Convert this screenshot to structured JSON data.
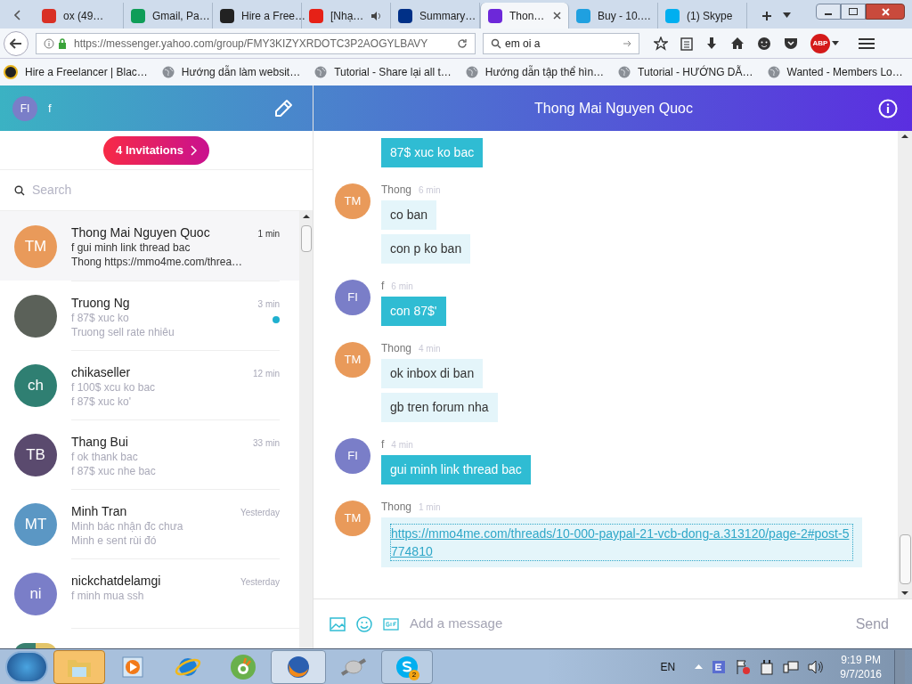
{
  "browser": {
    "tabs": [
      {
        "title": "ox (49…",
        "color": "#d93025",
        "selected": false,
        "audio": false
      },
      {
        "title": "Gmail, Pa…",
        "color": "#0f9d58",
        "selected": false,
        "audio": false
      },
      {
        "title": "Hire a Free…",
        "color": "#222222",
        "selected": false,
        "audio": false
      },
      {
        "title": "[Nhạ…",
        "color": "#e62117",
        "selected": false,
        "audio": true
      },
      {
        "title": "Summary…",
        "color": "#003087",
        "selected": false,
        "audio": false
      },
      {
        "title": "Thon…",
        "color": "#6d28d9",
        "selected": true,
        "audio": false
      },
      {
        "title": "Buy - 10.…",
        "color": "#1fa0e0",
        "selected": false,
        "audio": false
      },
      {
        "title": "(1) Skype",
        "color": "#00aff0",
        "selected": false,
        "audio": false
      }
    ],
    "url": "https://messenger.yahoo.com/group/FMY3KIZYXRDOTC3P2AOGYLBAVY",
    "search_value": "em oi a",
    "adblock_label": "ABP",
    "bookmarks": [
      "Hire a Freelancer | Blac…",
      "Hướng dẫn làm websit…",
      "Tutorial - Share lại all t…",
      "Hướng dẫn tập thể hìn…",
      "Tutorial - HƯỚNG DẪ…",
      "Wanted - Members Lo…"
    ]
  },
  "me": {
    "initials": "FI",
    "name": "f"
  },
  "invitations": "4 Invitations",
  "search": {
    "placeholder": "Search"
  },
  "conversations": [
    {
      "kind": "initials",
      "initials": "TM",
      "color": "#e99a5a",
      "name": "Thong Mai Nguyen Quoc",
      "line1": "f gui minh link thread bac",
      "line2": "Thong https://mmo4me.com/threa…",
      "time": "1 min",
      "unread": false,
      "selected": true
    },
    {
      "kind": "photo",
      "name": "Truong Ng",
      "line1": "f 87$ xuc ko",
      "line2": "Truong sell rate nhiêu",
      "time": "3 min",
      "unread": true,
      "selected": false
    },
    {
      "kind": "initials",
      "initials": "ch",
      "color": "#2f7f72",
      "name": "chikaseller",
      "line1": "f 100$ xcu ko bac",
      "line2": "f 87$ xuc ko'",
      "time": "12 min",
      "unread": false,
      "selected": false
    },
    {
      "kind": "initials",
      "initials": "TB",
      "color": "#5a4a6e",
      "name": "Thang Bui",
      "line1": "f ok thank bac",
      "line2": "f 87$ xuc nhe bac",
      "time": "33 min",
      "unread": false,
      "selected": false
    },
    {
      "kind": "initials",
      "initials": "MT",
      "color": "#5b97c4",
      "name": "Minh Tran",
      "line1": "Minh bác nhận đc chưa",
      "line2": "Minh e sent rùi đó",
      "time": "Yesterday",
      "unread": false,
      "selected": false
    },
    {
      "kind": "initials",
      "initials": "ni",
      "color": "#7a7ec8",
      "name": "nickchatdelamgi",
      "line1": "f minh mua ssh",
      "time": "Yesterday",
      "unread": false,
      "selected": false
    }
  ],
  "chat": {
    "title": "Thong Mai Nguyen Quoc",
    "groups": [
      {
        "mine": true,
        "messages": [
          {
            "kind": "text",
            "text": "87$ xuc ko bac"
          }
        ]
      },
      {
        "mine": false,
        "initials": "TM",
        "sender": "Thong",
        "time": "6 min",
        "messages": [
          {
            "kind": "text",
            "text": "co ban"
          },
          {
            "kind": "text",
            "text": "con p ko ban"
          }
        ]
      },
      {
        "mine": true,
        "initials": "FI",
        "sender": "f",
        "time": "6 min",
        "messages": [
          {
            "kind": "text",
            "text": "con 87$'"
          }
        ]
      },
      {
        "mine": false,
        "initials": "TM",
        "sender": "Thong",
        "time": "4 min",
        "messages": [
          {
            "kind": "text",
            "text": "ok inbox di ban"
          },
          {
            "kind": "text",
            "text": "gb tren forum nha"
          }
        ]
      },
      {
        "mine": true,
        "initials": "FI",
        "sender": "f",
        "time": "4 min",
        "messages": [
          {
            "kind": "text",
            "text": "gui minh link thread bac"
          }
        ]
      },
      {
        "mine": false,
        "initials": "TM",
        "sender": "Thong",
        "time": "1 min",
        "messages": [
          {
            "kind": "link",
            "text": "https://mmo4me.com/threads/10-000-paypal-21-vcb-dong-a.313120/page-2#post-5774810"
          }
        ]
      }
    ],
    "composer_placeholder": "Add a message",
    "send": "Send"
  },
  "taskbar": {
    "skype_badge": "2",
    "language": "EN",
    "time": "9:19 PM",
    "date": "9/7/2016"
  }
}
